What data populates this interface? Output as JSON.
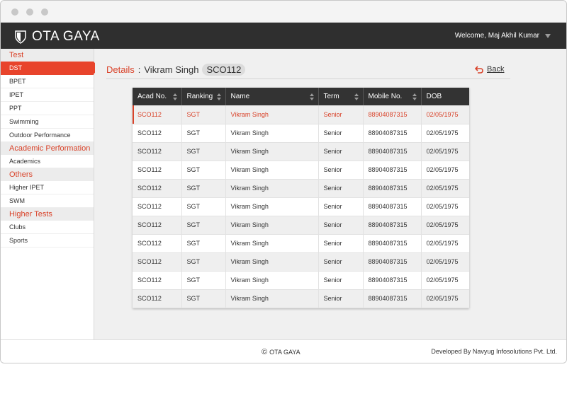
{
  "header": {
    "logo_text": "OTA GAYA",
    "welcome": "Welcome, Maj Akhil Kumar"
  },
  "sidebar": {
    "sections": [
      {
        "title": "Test",
        "items": [
          "DST",
          "BPET",
          "IPET",
          "PPT",
          "Swimming",
          "Outdoor Performance"
        ]
      },
      {
        "title": "Academic Performation",
        "items": [
          "Academics"
        ]
      },
      {
        "title": "Others",
        "items": [
          "Higher IPET",
          "SWM"
        ]
      },
      {
        "title": "Higher Tests",
        "items": [
          "Clubs",
          "Sports"
        ]
      }
    ],
    "active_item": "DST"
  },
  "details": {
    "label": "Details",
    "separator": ":",
    "name": "Vikram Singh",
    "code": "SCO112"
  },
  "back": {
    "label": "Back"
  },
  "table": {
    "columns": [
      "Acad No.",
      "Ranking",
      "Name",
      "Term",
      "Mobile No.",
      "DOB"
    ],
    "rows": [
      [
        "SCO112",
        "SGT",
        "Vikram Singh",
        "Senior",
        "88904087315",
        "02/05/1975"
      ],
      [
        "SCO112",
        "SGT",
        "Vikram Singh",
        "Senior",
        "88904087315",
        "02/05/1975"
      ],
      [
        "SCO112",
        "SGT",
        "Vikram Singh",
        "Senior",
        "88904087315",
        "02/05/1975"
      ],
      [
        "SCO112",
        "SGT",
        "Vikram Singh",
        "Senior",
        "88904087315",
        "02/05/1975"
      ],
      [
        "SCO112",
        "SGT",
        "Vikram Singh",
        "Senior",
        "88904087315",
        "02/05/1975"
      ],
      [
        "SCO112",
        "SGT",
        "Vikram Singh",
        "Senior",
        "88904087315",
        "02/05/1975"
      ],
      [
        "SCO112",
        "SGT",
        "Vikram Singh",
        "Senior",
        "88904087315",
        "02/05/1975"
      ],
      [
        "SCO112",
        "SGT",
        "Vikram Singh",
        "Senior",
        "88904087315",
        "02/05/1975"
      ],
      [
        "SCO112",
        "SGT",
        "Vikram Singh",
        "Senior",
        "88904087315",
        "02/05/1975"
      ],
      [
        "SCO112",
        "SGT",
        "Vikram Singh",
        "Senior",
        "88904087315",
        "02/05/1975"
      ],
      [
        "SCO112",
        "SGT",
        "Vikram Singh",
        "Senior",
        "88904087315",
        "02/05/1975"
      ]
    ],
    "highlighted_row": 0
  },
  "footer": {
    "copyright_symbol": "©",
    "copyright": "OTA GAYA",
    "developer": "Developed By Navyug Infosolutions Pvt. Ltd."
  },
  "colors": {
    "accent": "#e8442c",
    "header_bg": "#2f2f2f",
    "table_header_bg": "#333333"
  },
  "icons": {
    "logo": "shield-icon",
    "user_menu": "caret-down-icon",
    "back": "back-arrow-icon",
    "sort": "sort-icon"
  }
}
